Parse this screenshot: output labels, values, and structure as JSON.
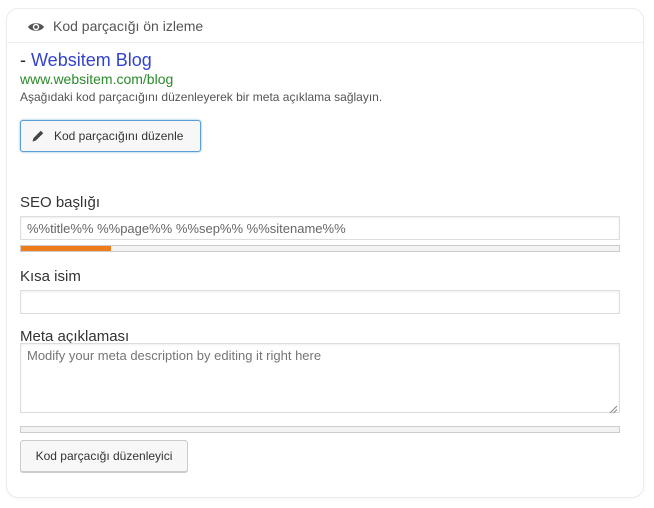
{
  "header": {
    "icon": "eye-icon",
    "title": "Kod parçacığı ön izleme"
  },
  "preview": {
    "separator": "-",
    "title": "Websitem Blog",
    "url": "www.websitem.com/blog",
    "description": "Aşağıdaki kod parçacığını düzenleyerek bir meta açıklama sağlayın."
  },
  "edit_button": {
    "icon": "pencil-icon",
    "label": "Kod parçacığını düzenle"
  },
  "seo_title": {
    "label": "SEO başlığı",
    "value": "%%title%% %%page%% %%sep%% %%sitename%%",
    "progress_percent": 15,
    "progress_color": "#ee7c1b"
  },
  "slug": {
    "label": "Kısa isim",
    "value": ""
  },
  "meta_description": {
    "label": "Meta açıklaması",
    "placeholder": "Modify your meta description by editing it right here",
    "progress_percent": 0
  },
  "close_button": {
    "label": "Kod parçacığı düzenleyici"
  }
}
